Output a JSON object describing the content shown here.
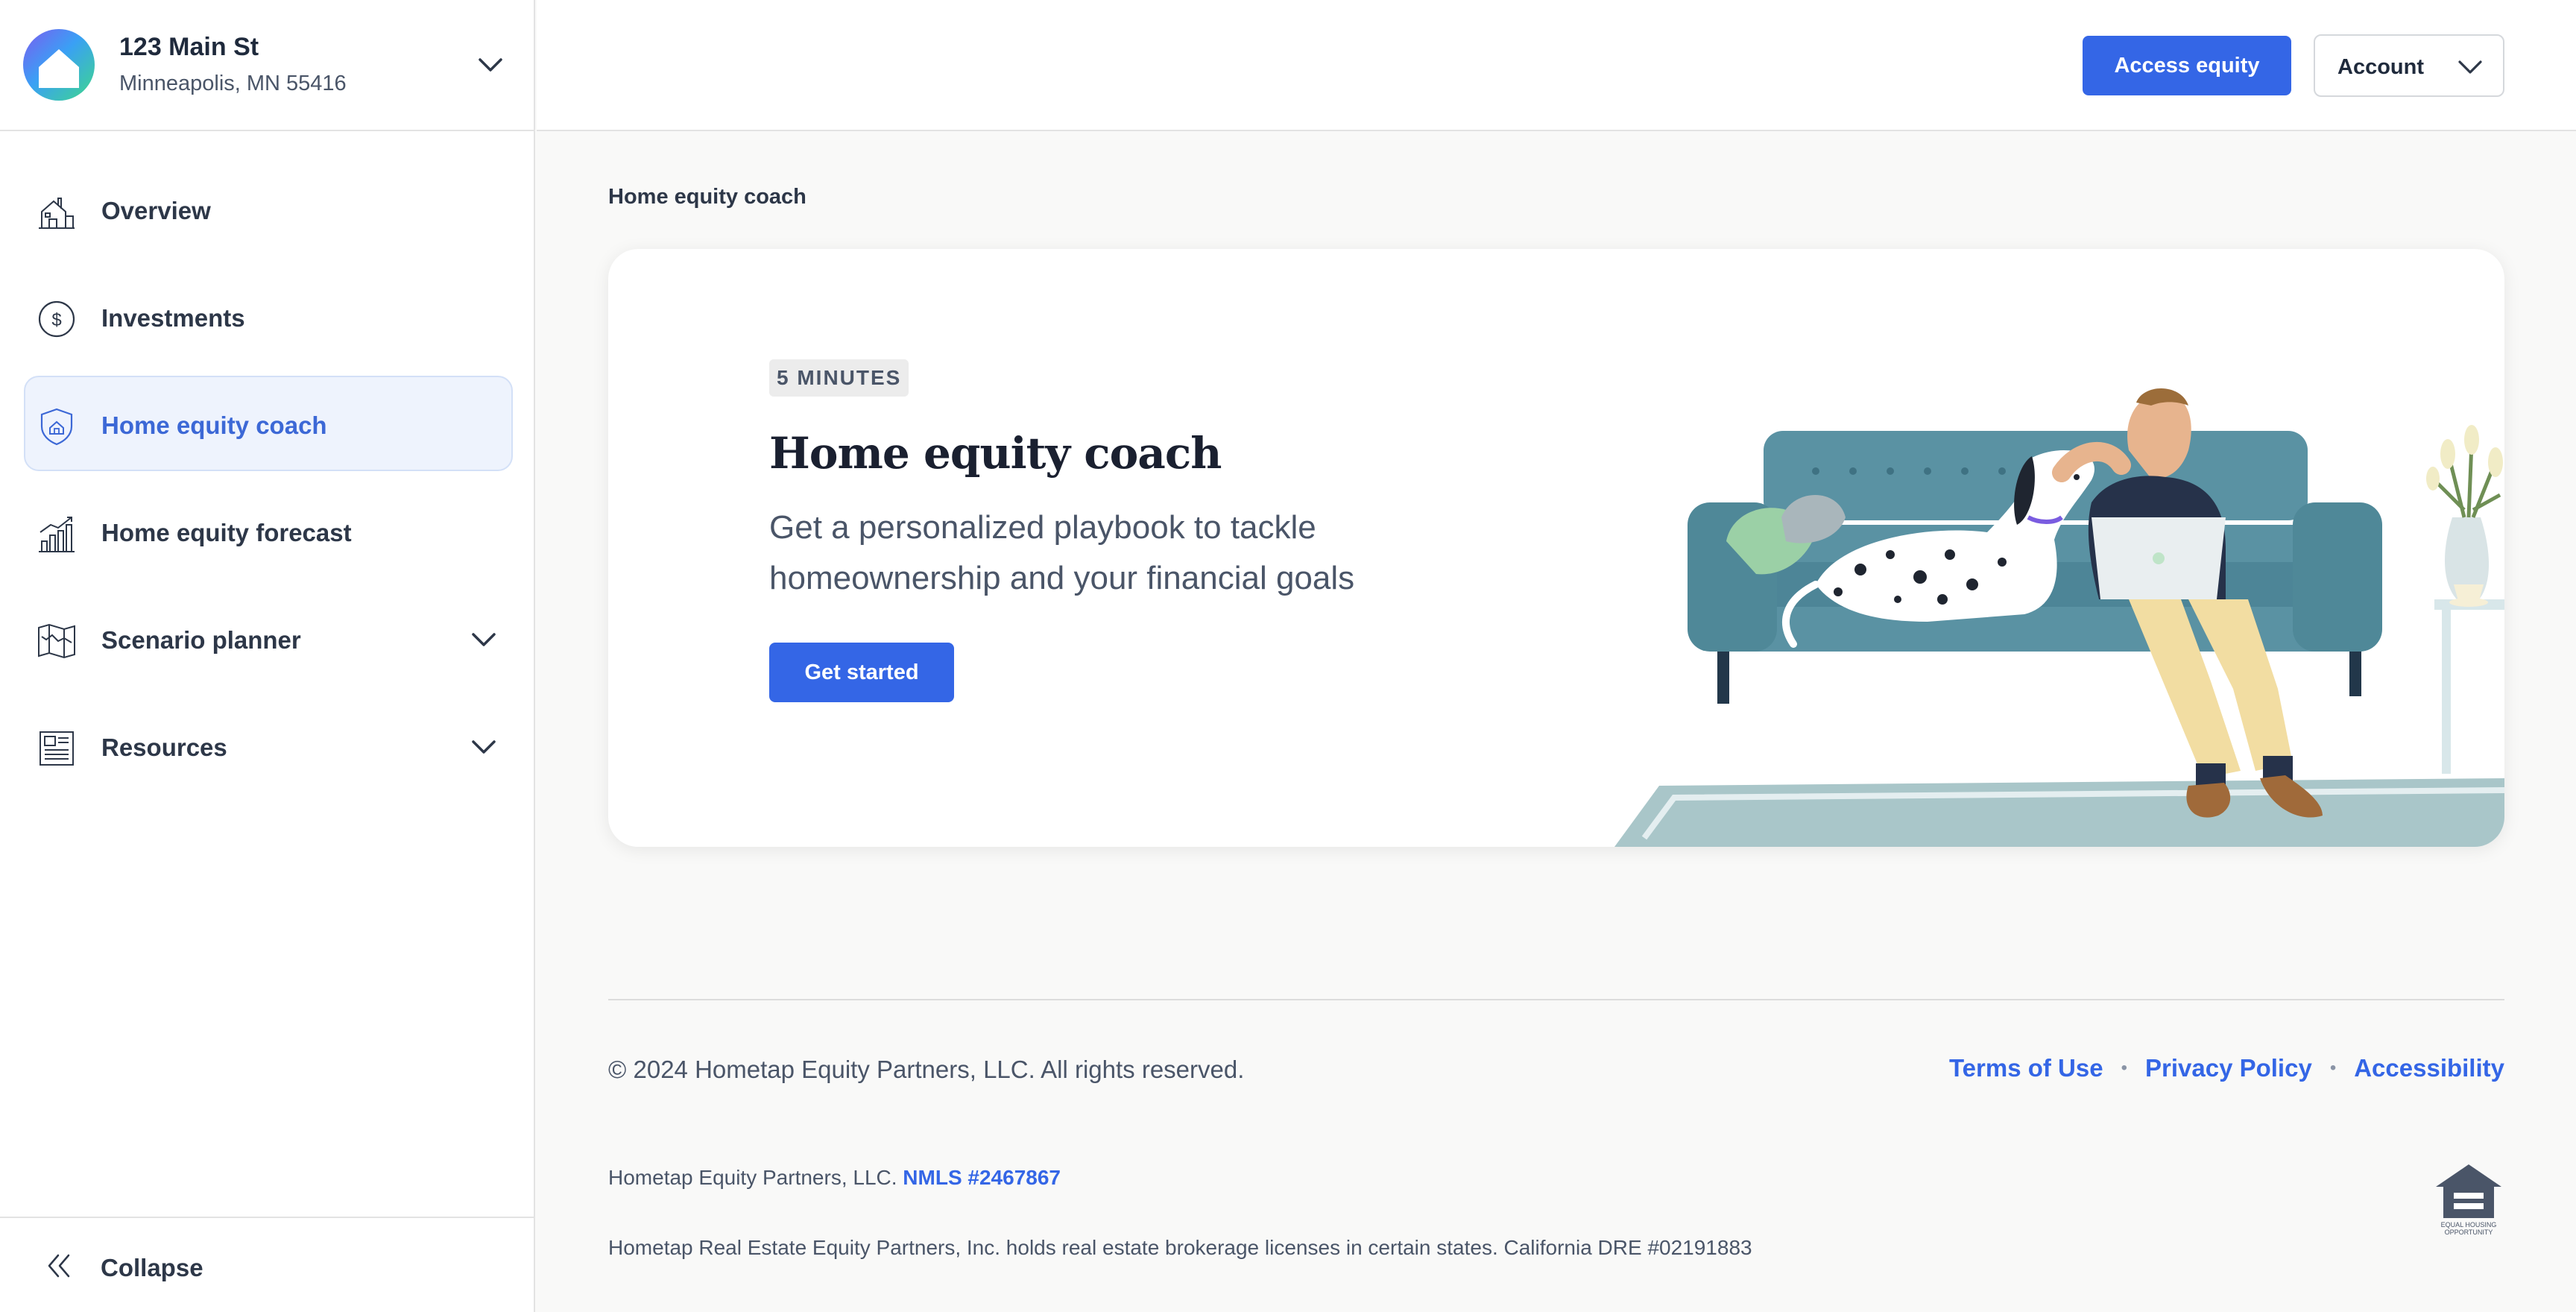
{
  "property": {
    "address_line1": "123 Main St",
    "address_line2": "Minneapolis, MN 55416"
  },
  "sidebar": {
    "items": [
      {
        "label": "Overview",
        "icon": "house-icon",
        "active": false
      },
      {
        "label": "Investments",
        "icon": "dollar-circle-icon",
        "active": false
      },
      {
        "label": "Home equity coach",
        "icon": "shield-home-icon",
        "active": true
      },
      {
        "label": "Home equity forecast",
        "icon": "bar-chart-icon",
        "active": false
      },
      {
        "label": "Scenario planner",
        "icon": "map-icon",
        "active": false,
        "expandable": true
      },
      {
        "label": "Resources",
        "icon": "newspaper-icon",
        "active": false,
        "expandable": true
      }
    ],
    "collapse_label": "Collapse"
  },
  "header": {
    "access_equity_label": "Access equity",
    "account_label": "Account"
  },
  "main": {
    "breadcrumb": "Home equity coach",
    "card": {
      "badge": "5 MINUTES",
      "title": "Home equity coach",
      "description": "Get a personalized playbook to tackle homeownership and your financial goals",
      "cta_label": "Get started"
    }
  },
  "footer": {
    "copyright": "© 2024 Hometap Equity Partners, LLC. All rights reserved.",
    "links": [
      "Terms of Use",
      "Privacy Policy",
      "Accessibility"
    ],
    "separator": "•",
    "nmls_prefix": "Hometap Equity Partners, LLC.",
    "nmls_link": "NMLS #2467867",
    "dre_text": "Hometap Real Estate Equity Partners, Inc. holds real estate brokerage licenses in certain states. California DRE #02191883",
    "eho_text": "EQUAL HOUSING OPPORTUNITY"
  },
  "colors": {
    "accent": "#3466e6",
    "active_bg": "#eef3fd",
    "sofa": "#5a92a3"
  }
}
